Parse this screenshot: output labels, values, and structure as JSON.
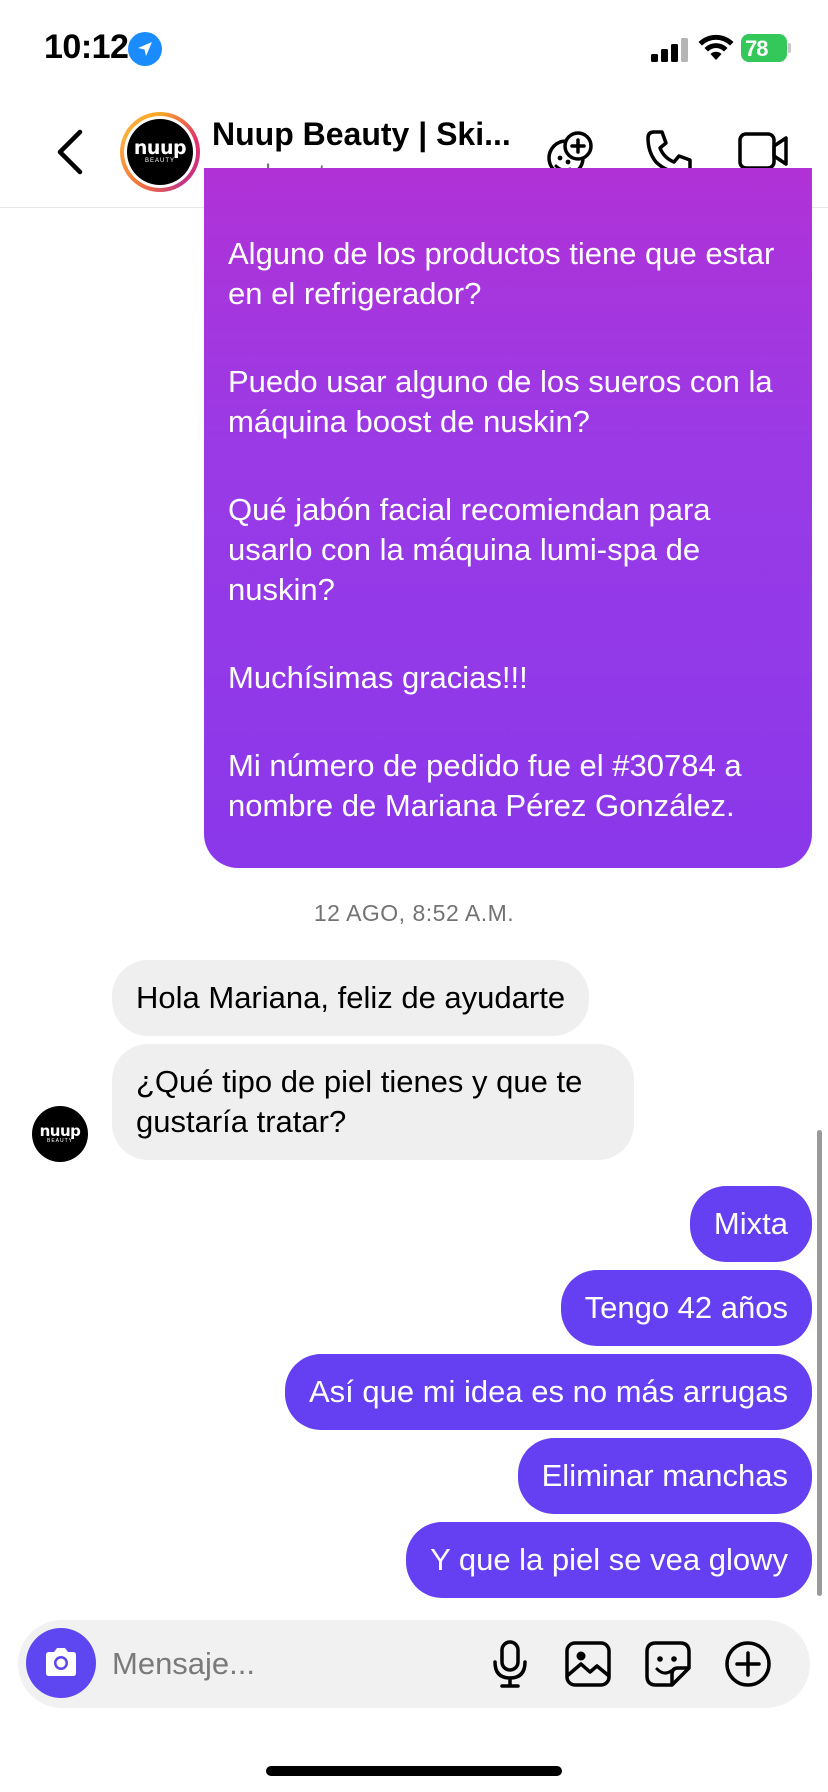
{
  "status_bar": {
    "time": "10:12",
    "battery": "78"
  },
  "header": {
    "contact_name": "Nuup Beauty | Ski...",
    "handle": "nuupbeauty",
    "logo_text": "nuup",
    "logo_subtext": "BEAUTY",
    "icons": [
      "back-icon",
      "effects-icon",
      "phone-icon",
      "video-icon"
    ]
  },
  "messages": {
    "outgoing_long": [
      "Alguno de los productos tiene que estar en el refrigerador?",
      "Puedo usar alguno de los sueros con la máquina boost de nuskin?",
      "Qué jabón facial recomiendan para usarlo con la máquina lumi-spa de nuskin?",
      "Muchísimas gracias!!!",
      "Mi número de pedido fue el #30784 a nombre de Mariana Pérez González."
    ],
    "timestamp": "12 AGO, 8:52 A.M.",
    "incoming": [
      "Hola Mariana, feliz de ayudarte",
      "¿Qué tipo de piel tienes y que te gustaría tratar?"
    ],
    "outgoing": [
      "Mixta",
      "Tengo 42 años",
      "Así que mi idea es no más arrugas",
      "Eliminar manchas",
      "Y que la piel se vea glowy"
    ]
  },
  "composer": {
    "placeholder": "Mensaje...",
    "icons": [
      "camera-icon",
      "microphone-icon",
      "gallery-icon",
      "sticker-icon",
      "plus-icon"
    ]
  },
  "colors": {
    "outgoing_bubble": "#6440f2",
    "gradient_top": "#b032d6",
    "gradient_bottom": "#8a38ea",
    "incoming_bubble": "#efeff0",
    "battery": "#34c759",
    "location": "#1a8cff"
  }
}
